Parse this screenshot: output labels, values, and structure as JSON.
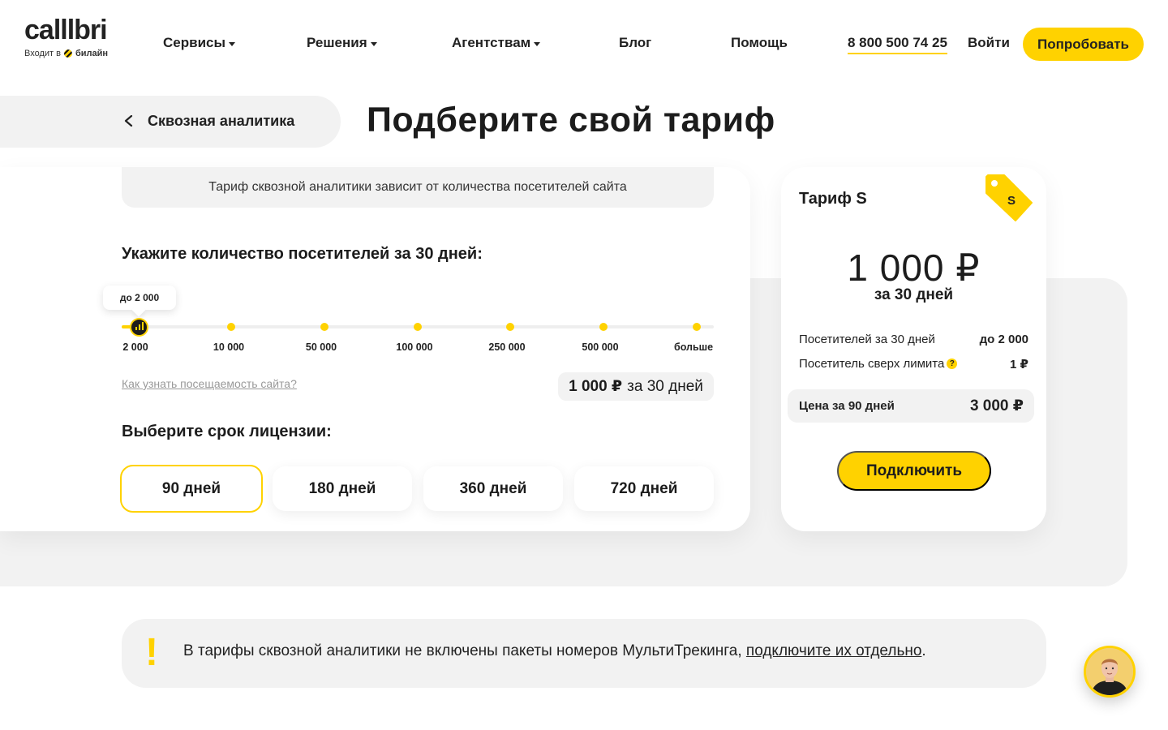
{
  "header": {
    "logo_text": "calllbri",
    "logo_sub_prefix": "Входит в",
    "logo_sub_brand": "билайн",
    "nav": {
      "services": "Сервисы",
      "solutions": "Решения",
      "agencies": "Агентствам",
      "blog": "Блог",
      "help": "Помощь"
    },
    "phone": "8 800 500 74 25",
    "login": "Войти",
    "try_button": "Попробовать"
  },
  "back": {
    "label": "Сквозная аналитика"
  },
  "page_title": "Подберите свой тариф",
  "calculator": {
    "info": "Тариф сквозной аналитики зависит от количества посетителей сайта",
    "visitors_title": "Укажите количество посетителей за 30 дней:",
    "tooltip": "до 2 000",
    "ticks": [
      "2 000",
      "10 000",
      "50 000",
      "100 000",
      "250 000",
      "500 000",
      "больше"
    ],
    "selected_index": 0,
    "help_link": "Как узнать посещаемость сайта?",
    "price_amount": "1 000 ₽",
    "price_period": "за 30 дней",
    "license_title": "Выберите срок лицензии:",
    "terms": [
      "90 дней",
      "180 дней",
      "360 дней",
      "720 дней"
    ],
    "active_term_index": 0
  },
  "tariff": {
    "name": "Тариф S",
    "badge": "S",
    "price": "1 000 ₽",
    "period": "за 30 дней",
    "rows": [
      {
        "label": "Посетителей за 30 дней",
        "value": "до 2 000"
      },
      {
        "label": "Посетитель сверх лимита",
        "value": "1 ₽",
        "help_icon": "?"
      }
    ],
    "total_label": "Цена за 90 дней",
    "total_value": "3 000 ₽",
    "connect_button": "Подключить"
  },
  "notice": {
    "mark": "!",
    "text": "В тарифы сквозной аналитики не включены пакеты номеров МультиТрекинга, ",
    "link": "подключите их отдельно",
    "end": "."
  },
  "colors": {
    "accent": "#ffd200",
    "text": "#1c1c1c",
    "panel": "#f2f2f2"
  }
}
